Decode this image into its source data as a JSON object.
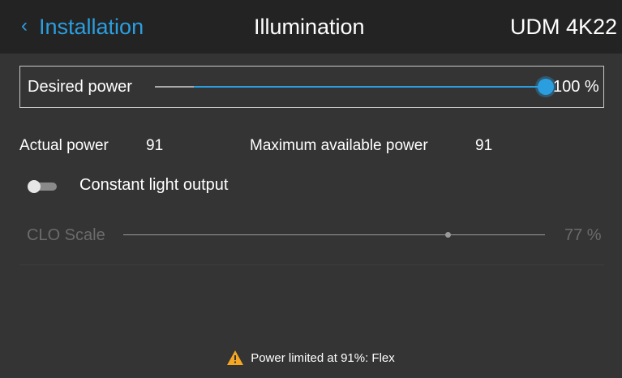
{
  "header": {
    "back_label": "Installation",
    "title": "Illumination",
    "device": "UDM 4K22"
  },
  "desired_power": {
    "label": "Desired power",
    "value": 100,
    "value_text": "100 %"
  },
  "actual_power": {
    "label": "Actual power",
    "value": "91"
  },
  "max_power": {
    "label": "Maximum available power",
    "value": "91"
  },
  "clo": {
    "label": "Constant light output",
    "enabled": false
  },
  "clo_scale": {
    "label": "CLO Scale",
    "value": 77,
    "value_text": "77 %",
    "disabled": true
  },
  "status": {
    "icon": "warning-icon",
    "text": "Power limited at 91%: Flex"
  },
  "colors": {
    "accent": "#2b9ee0",
    "warning": "#f5a623",
    "background": "#343434",
    "header_background": "#232323"
  }
}
